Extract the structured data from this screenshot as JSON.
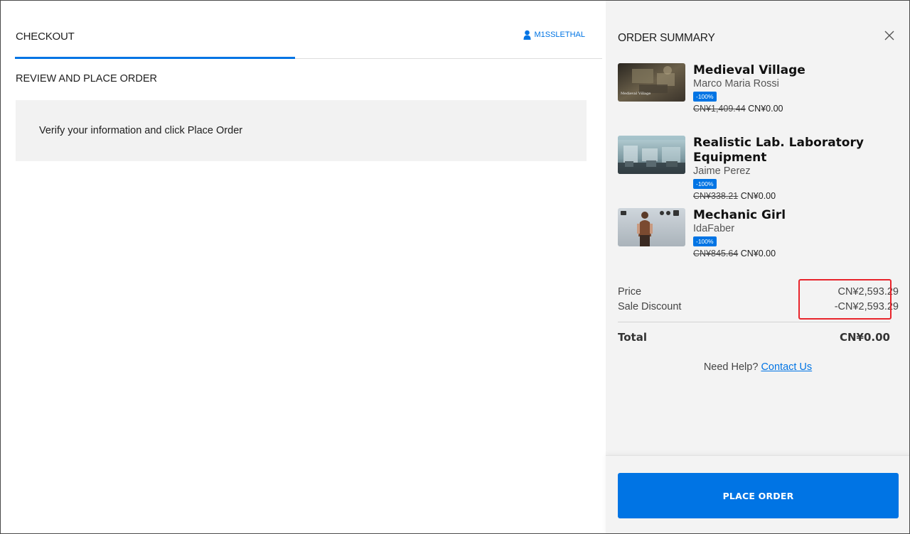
{
  "checkout": {
    "tab_label": "CHECKOUT",
    "username": "M1SSLETHAL",
    "section_title": "REVIEW AND PLACE ORDER",
    "info_message": "Verify your information and click Place Order"
  },
  "summary": {
    "title": "ORDER SUMMARY",
    "items": [
      {
        "title": "Medieval Village",
        "author": "Marco Maria Rossi",
        "discount": "-100%",
        "original_price": "CN¥1,409.44",
        "sale_price": "CN¥0.00",
        "thumb_text": "Medieval Village"
      },
      {
        "title": "Realistic Lab. Laboratory Equipment",
        "author": "Jaime Perez",
        "discount": "-100%",
        "original_price": "CN¥338.21",
        "sale_price": "CN¥0.00",
        "thumb_text": ""
      },
      {
        "title": "Mechanic Girl",
        "author": "IdaFaber",
        "discount": "-100%",
        "original_price": "CN¥845.64",
        "sale_price": "CN¥0.00",
        "thumb_text": ""
      }
    ],
    "price_label": "Price",
    "price_value": "CN¥2,593.29",
    "discount_label": "Sale Discount",
    "discount_value": "-CN¥2,593.29",
    "total_label": "Total",
    "total_value": "CN¥0.00",
    "help_text": "Need Help?",
    "help_link": "Contact Us",
    "place_order_label": "PLACE ORDER"
  },
  "colors": {
    "accent": "#0074e4",
    "highlight": "#e8242b",
    "panel_bg": "#f3f3f3"
  }
}
